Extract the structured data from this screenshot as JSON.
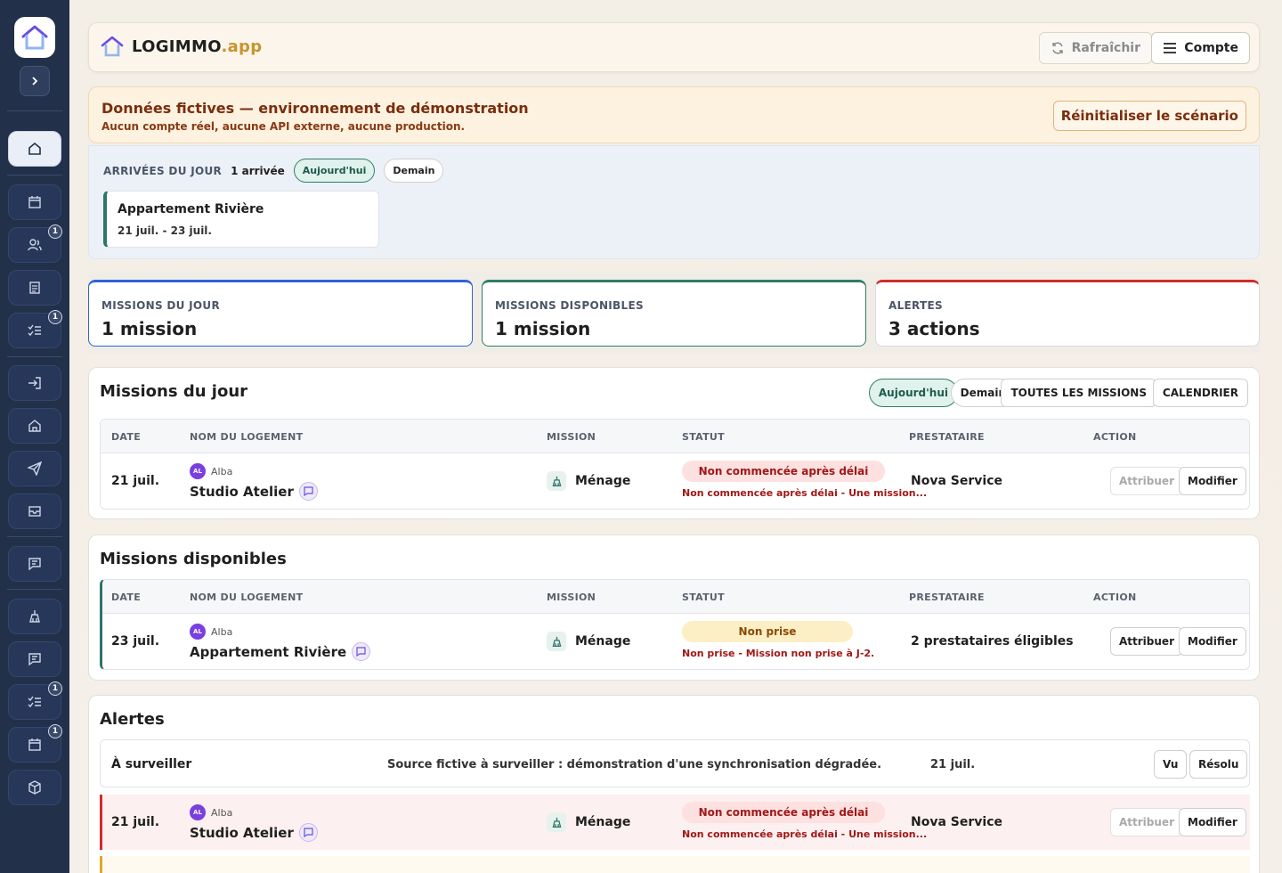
{
  "brand": {
    "name": "LOGIMMO",
    "suffix": ".app"
  },
  "header": {
    "refresh_label": "Rafraîchir",
    "account_label": "Compte"
  },
  "demo": {
    "title": "Données fictives — environnement de démonstration",
    "subtitle": "Aucun compte réel, aucune API externe, aucune production.",
    "reset_label": "Réinitialiser le scénario"
  },
  "arrivals": {
    "title": "ARRIVÉES DU JOUR",
    "count": "1 arrivée",
    "tab_today": "Aujourd'hui",
    "tab_tomorrow": "Demain",
    "card": {
      "name": "Appartement Rivière",
      "dates": "21 juil. - 23 juil."
    }
  },
  "kpis": [
    {
      "label": "MISSIONS DU JOUR",
      "value": "1 mission",
      "color": "#2f63d8"
    },
    {
      "label": "MISSIONS DISPONIBLES",
      "value": "1 mission",
      "color": "#2f7d68"
    },
    {
      "label": "ALERTES",
      "value": "3 actions",
      "color": "#d12b2b"
    }
  ],
  "columns": {
    "date": "DATE",
    "logement": "NOM DU LOGEMENT",
    "mission": "MISSION",
    "statut": "STATUT",
    "prestataire": "PRESTATAIRE",
    "action": "ACTION"
  },
  "missions_jour": {
    "title": "Missions du jour",
    "tab_today": "Aujourd'hui",
    "tab_tomorrow": "Demain",
    "all_label": "TOUTES LES MISSIONS",
    "calendar_label": "CALENDRIER",
    "row": {
      "date": "21 juil.",
      "owner_initials": "AL",
      "owner": "Alba",
      "logement": "Studio Atelier",
      "mission": "Ménage",
      "status": "Non commencée après délai",
      "note": "Non commencée après délai - Une mission...",
      "prestataire": "Nova Service",
      "assign": "Attribuer",
      "edit": "Modifier"
    }
  },
  "missions_dispo": {
    "title": "Missions disponibles",
    "row": {
      "date": "23 juil.",
      "owner_initials": "AL",
      "owner": "Alba",
      "logement": "Appartement Rivière",
      "mission": "Ménage",
      "status": "Non prise",
      "note": "Non prise - Mission non prise à J-2.",
      "prestataire": "2 prestataires éligibles",
      "assign": "Attribuer",
      "edit": "Modifier"
    }
  },
  "alertes": {
    "title": "Alertes",
    "watch": {
      "label": "À surveiller",
      "message": "Source fictive à surveiller : démonstration d'une synchronisation dégradée.",
      "date": "21 juil.",
      "seen": "Vu",
      "resolved": "Résolu"
    },
    "row": {
      "date": "21 juil.",
      "owner_initials": "AL",
      "owner": "Alba",
      "logement": "Studio Atelier",
      "mission": "Ménage",
      "status": "Non commencée après délai",
      "note": "Non commencée après délai - Une mission...",
      "prestataire": "Nova Service",
      "assign": "Attribuer",
      "edit": "Modifier"
    }
  },
  "sidebar_badges": {
    "b1": "1",
    "b2": "1",
    "b3": "1",
    "b4": "1"
  }
}
